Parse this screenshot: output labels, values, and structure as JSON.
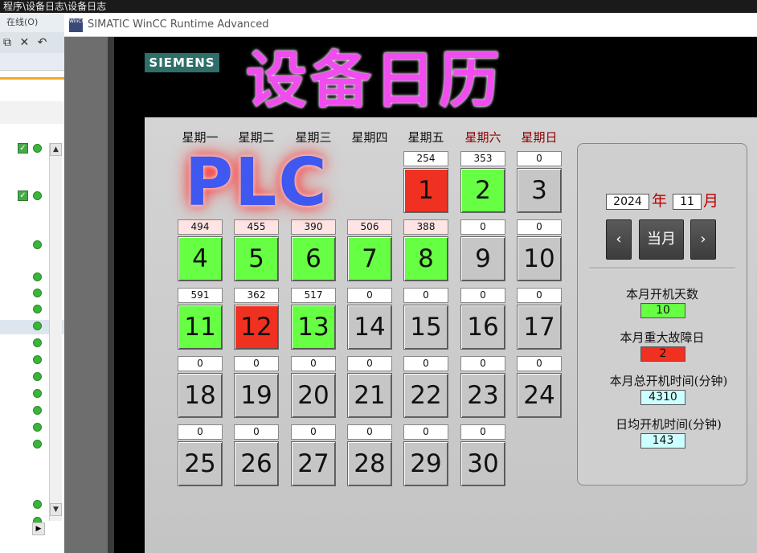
{
  "background_app": {
    "title": "程序\\设备日志\\设备日志",
    "menu_item": "在线(O)",
    "toolbar_icons": [
      "copy-icon",
      "delete-icon",
      "undo-icon"
    ]
  },
  "window": {
    "title": "SIMATIC WinCC Runtime Advanced",
    "icon_text": "WinCC"
  },
  "header": {
    "brand": "SIEMENS",
    "title": "设备日历",
    "overlay": "PLC"
  },
  "calendar": {
    "weekdays": [
      "星期一",
      "星期二",
      "星期三",
      "星期四",
      "星期五",
      "星期六",
      "星期日"
    ],
    "weekend_color": "#8b0000",
    "colors": {
      "running": "#66ff44",
      "fault": "#f03020",
      "idle": "#c6c6c6"
    },
    "days": [
      {
        "day": "1",
        "count": "254",
        "status": "fault"
      },
      {
        "day": "2",
        "count": "353",
        "status": "running"
      },
      {
        "day": "3",
        "count": "0",
        "status": "idle"
      },
      {
        "day": "4",
        "count": "494",
        "status": "running"
      },
      {
        "day": "5",
        "count": "455",
        "status": "running"
      },
      {
        "day": "6",
        "count": "390",
        "status": "running"
      },
      {
        "day": "7",
        "count": "506",
        "status": "running"
      },
      {
        "day": "8",
        "count": "388",
        "status": "running"
      },
      {
        "day": "9",
        "count": "0",
        "status": "idle"
      },
      {
        "day": "10",
        "count": "0",
        "status": "idle"
      },
      {
        "day": "11",
        "count": "591",
        "status": "running"
      },
      {
        "day": "12",
        "count": "362",
        "status": "fault"
      },
      {
        "day": "13",
        "count": "517",
        "status": "running"
      },
      {
        "day": "14",
        "count": "0",
        "status": "idle"
      },
      {
        "day": "15",
        "count": "0",
        "status": "idle"
      },
      {
        "day": "16",
        "count": "0",
        "status": "idle"
      },
      {
        "day": "17",
        "count": "0",
        "status": "idle"
      },
      {
        "day": "18",
        "count": "0",
        "status": "idle"
      },
      {
        "day": "19",
        "count": "0",
        "status": "idle"
      },
      {
        "day": "20",
        "count": "0",
        "status": "idle"
      },
      {
        "day": "21",
        "count": "0",
        "status": "idle"
      },
      {
        "day": "22",
        "count": "0",
        "status": "idle"
      },
      {
        "day": "23",
        "count": "0",
        "status": "idle"
      },
      {
        "day": "24",
        "count": "0",
        "status": "idle"
      },
      {
        "day": "25",
        "count": "0",
        "status": "idle"
      },
      {
        "day": "26",
        "count": "0",
        "status": "idle"
      },
      {
        "day": "27",
        "count": "0",
        "status": "idle"
      },
      {
        "day": "28",
        "count": "0",
        "status": "idle"
      },
      {
        "day": "29",
        "count": "0",
        "status": "idle"
      },
      {
        "day": "30",
        "count": "0",
        "status": "idle"
      }
    ]
  },
  "sidebar": {
    "year": "2024",
    "year_label": "年",
    "month": "11",
    "month_label": "月",
    "prev_label": "‹",
    "current_label": "当月",
    "next_label": "›",
    "stats": [
      {
        "label": "本月开机天数",
        "value": "10",
        "color": "#66ff44"
      },
      {
        "label": "本月重大故障日",
        "value": "2",
        "color": "#f03020"
      },
      {
        "label": "本月总开机时间(分钟)",
        "value": "4310",
        "color": "#ccffff"
      },
      {
        "label": "日均开机时间(分钟)",
        "value": "143",
        "color": "#ccffff"
      }
    ]
  }
}
